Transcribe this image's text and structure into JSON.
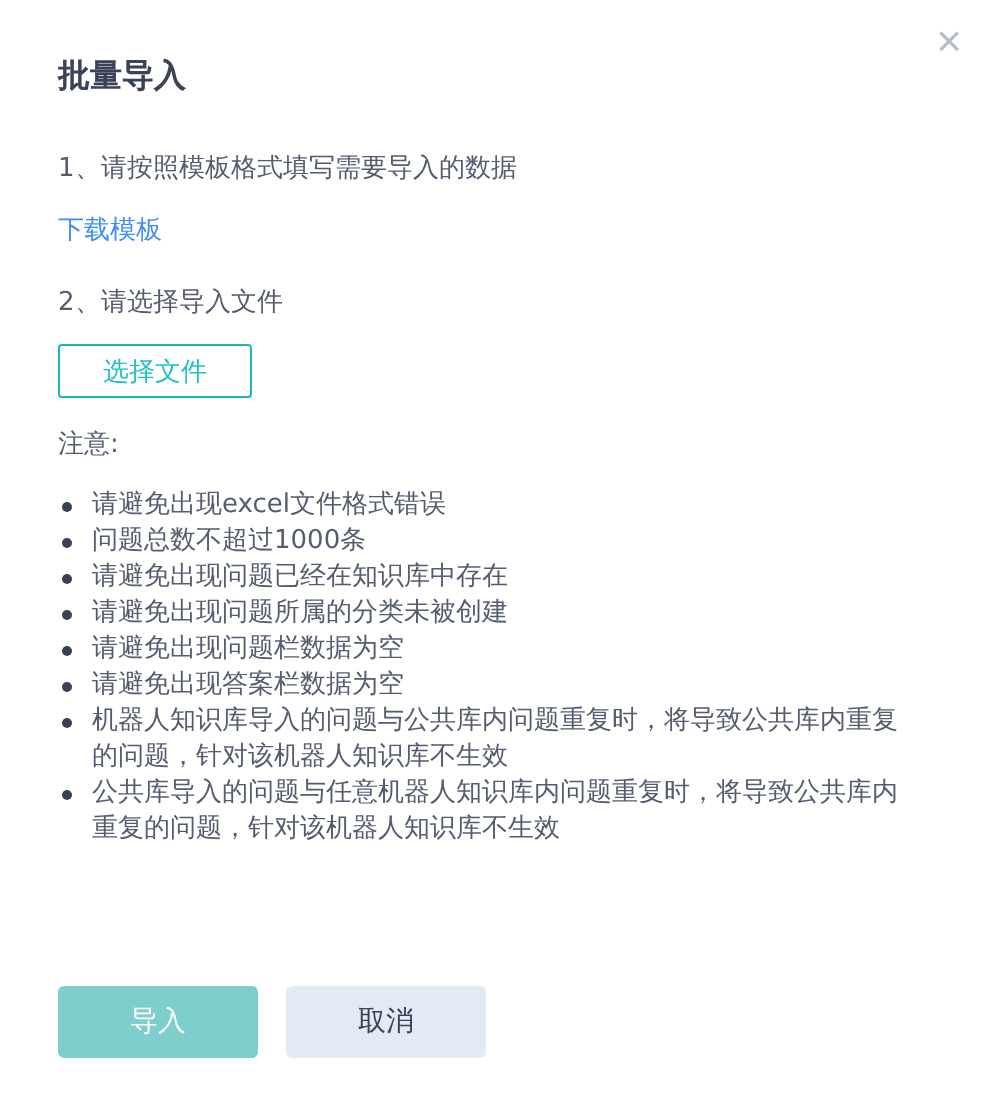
{
  "dialog": {
    "title": "批量导入",
    "close_label": "×",
    "step_1": "1、请按照模板格式填写需要导入的数据",
    "download_link": "下载模板",
    "step_2": "2、请选择导入文件",
    "choose_file_button": "选择文件",
    "notes_heading": "注意:",
    "notes": [
      "请避免出现excel文件格式错误",
      "问题总数不超过1000条",
      "请避免出现问题已经在知识库中存在",
      "请避免出现问题所属的分类未被创建",
      "请避免出现问题栏数据为空",
      "请避免出现答案栏数据为空",
      "机器人知识库导入的问题与公共库内问题重复时，将导致公共库内重复的问题，针对该机器人知识库不生效",
      "公共库导入的问题与任意机器人知识库内问题重复时，将导致公共库内重复的问题，针对该机器人知识库不生效"
    ],
    "buttons": [
      {
        "label": "导入",
        "kind": "primary",
        "disabled": true
      },
      {
        "label": "取消",
        "kind": "secondary",
        "disabled": false
      }
    ]
  }
}
